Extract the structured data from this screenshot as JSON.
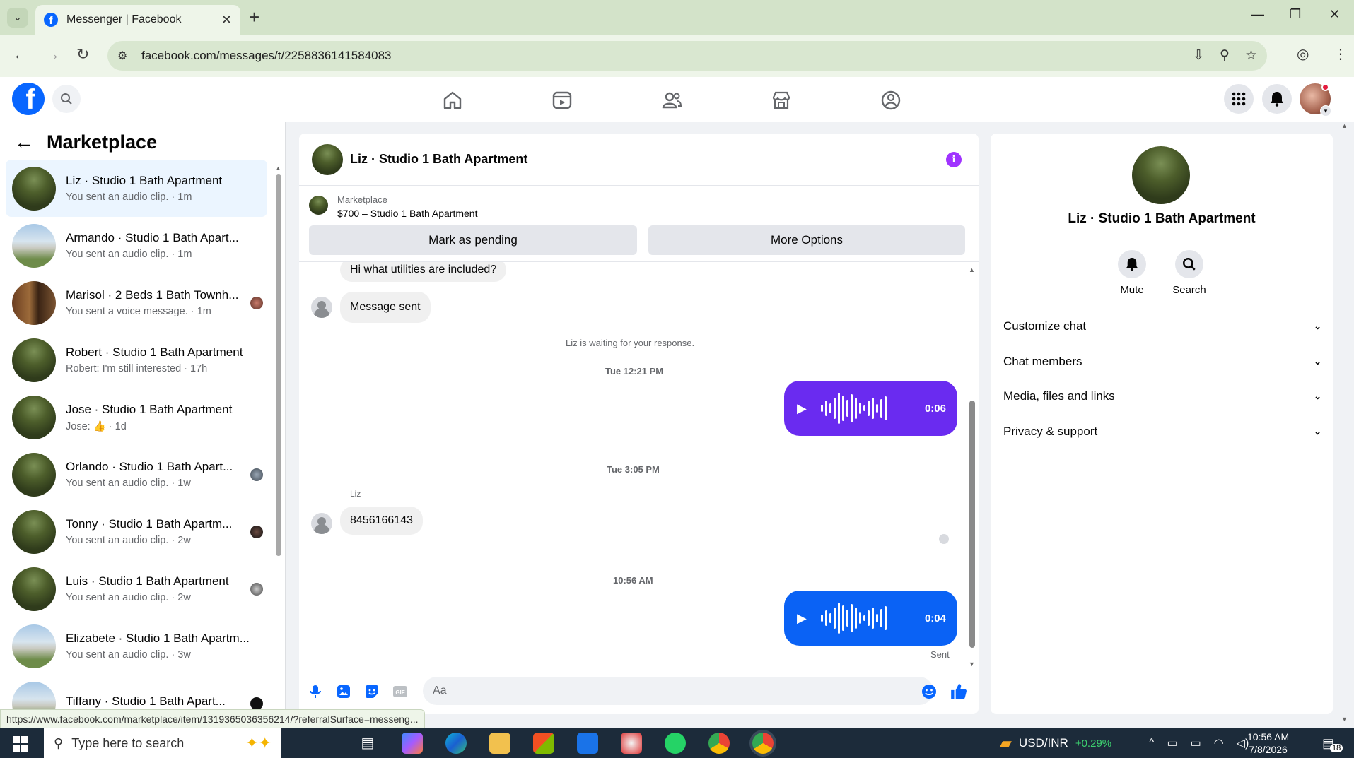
{
  "browser": {
    "tab_title": "Messenger | Facebook",
    "url": "facebook.com/messages/t/2258836141584083",
    "status_url": "https://www.facebook.com/marketplace/item/1319365036356214/?referralSurface=messeng..."
  },
  "sidebar": {
    "title": "Marketplace",
    "conversations": [
      {
        "name": "Liz · Studio 1 Bath Apartment",
        "preview": "You sent an audio clip. · 1m",
        "active": true
      },
      {
        "name": "Armando · Studio 1 Bath Apart...",
        "preview": "You sent an audio clip. · 1m"
      },
      {
        "name": "Marisol · 2 Beds 1 Bath Townh...",
        "preview": "You sent a voice message. · 1m"
      },
      {
        "name": "Robert · Studio 1 Bath Apartment",
        "preview": "Robert: I'm still interested · 17h"
      },
      {
        "name": "Jose · Studio 1 Bath Apartment",
        "preview_prefix": "Jose:",
        "preview": "· 1d"
      },
      {
        "name": "Orlando · Studio 1 Bath Apart...",
        "preview": "You sent an audio clip. · 1w"
      },
      {
        "name": "Tonny · Studio 1 Bath Apartm...",
        "preview": "You sent an audio clip. · 2w"
      },
      {
        "name": "Luis · Studio 1 Bath Apartment",
        "preview": "You sent an audio clip. · 2w"
      },
      {
        "name": "Elizabete · Studio 1 Bath Apartm...",
        "preview": "You sent an audio clip. · 3w"
      },
      {
        "name": "Tiffany · Studio 1 Bath Apart...",
        "preview": ""
      }
    ]
  },
  "chat": {
    "title": "Liz · Studio 1 Bath Apartment",
    "listing_label": "Marketplace",
    "listing_item": "$700 – Studio 1 Bath Apartment",
    "btn_pending": "Mark as pending",
    "btn_more": "More Options",
    "messages": {
      "m1": "Hi what utilities are included?",
      "m2": "Message sent",
      "waiting": "Liz is waiting for your response.",
      "ts1": "Tue 12:21 PM",
      "audio1_time": "0:06",
      "ts2": "Tue 3:05 PM",
      "sender": "Liz",
      "m3": "8456166143",
      "ts3": "10:56 AM",
      "audio2_time": "0:04",
      "sent": "Sent"
    },
    "input_placeholder": "Aa",
    "colors": {
      "audio1": "#6a2bf0",
      "audio2": "#0a62f5",
      "accent": "#0866ff"
    }
  },
  "rpanel": {
    "name": "Liz · Studio 1 Bath Apartment",
    "mute": "Mute",
    "search": "Search",
    "rows": [
      "Customize chat",
      "Chat members",
      "Media, files and links",
      "Privacy & support"
    ]
  },
  "taskbar": {
    "search_placeholder": "Type here to search",
    "ticker": "USD/INR",
    "ticker_change": "+0.29%",
    "time": "10:56 AM",
    "date": "7/8/2026",
    "notif_count": "18"
  }
}
